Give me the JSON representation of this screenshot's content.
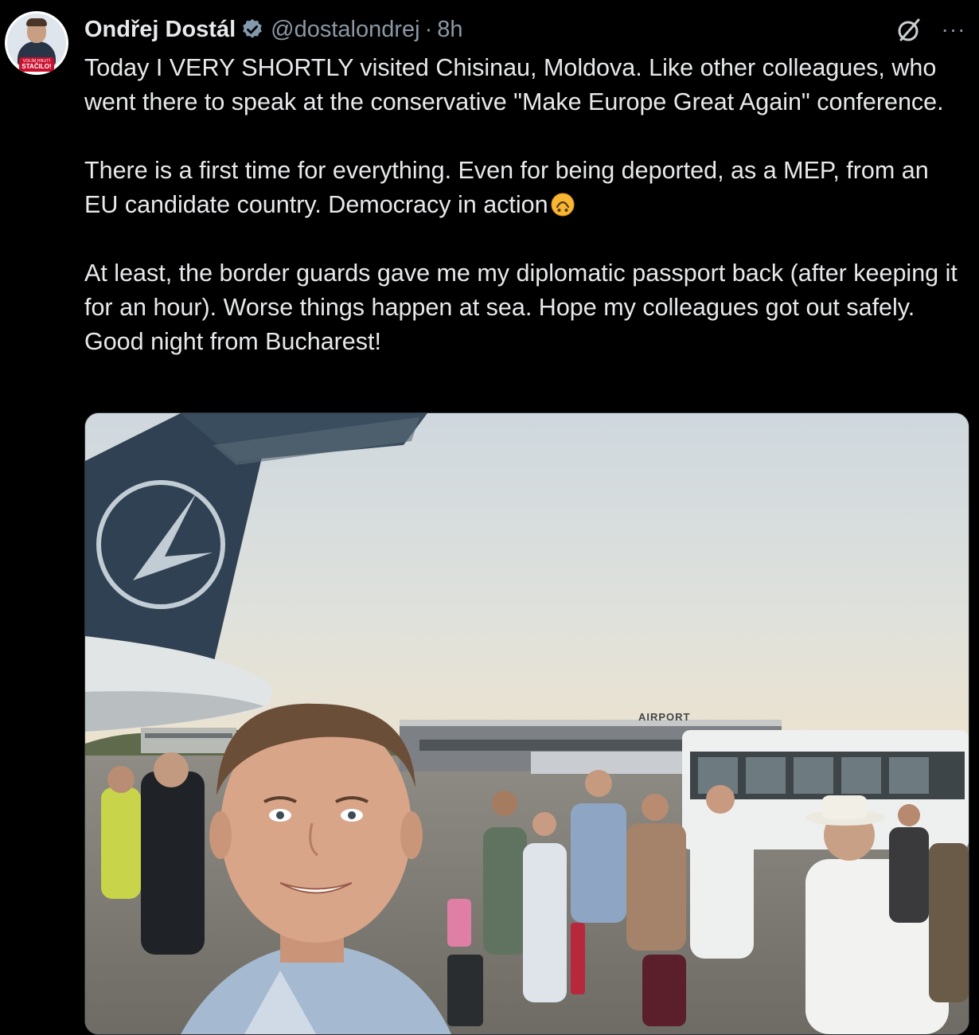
{
  "tweet": {
    "author": {
      "display_name": "Ondřej Dostál",
      "handle": "@dostalondrej",
      "verified": true,
      "avatar_badge_small": "VOLÍM HNUTÍ",
      "avatar_badge_big": "STAČILO!"
    },
    "separator": "·",
    "time": "8h",
    "more_label": "···",
    "text": {
      "paragraph1": "Today I VERY SHORTLY visited Chisinau, Moldova. Like other colleagues, who went there to speak at the conservative \"Make Europe Great Again\" conference.",
      "paragraph2": "There is a first time for everything. Even for being deported, as a MEP, from an EU candidate country. Democracy in action",
      "paragraph3": "At least, the border guards gave me my diplomatic passport back (after keeping it for an hour). Worse things happen at sea. Hope my colleagues got out safely. Good night from Bucharest!"
    },
    "media": {
      "airport_sign": "AIRPORT"
    }
  },
  "colors": {
    "background": "#000000",
    "text": "#e7e9ea",
    "secondary_text": "#8b98a5",
    "verified_badge": "#829aab",
    "media_border": "#2f3336"
  }
}
